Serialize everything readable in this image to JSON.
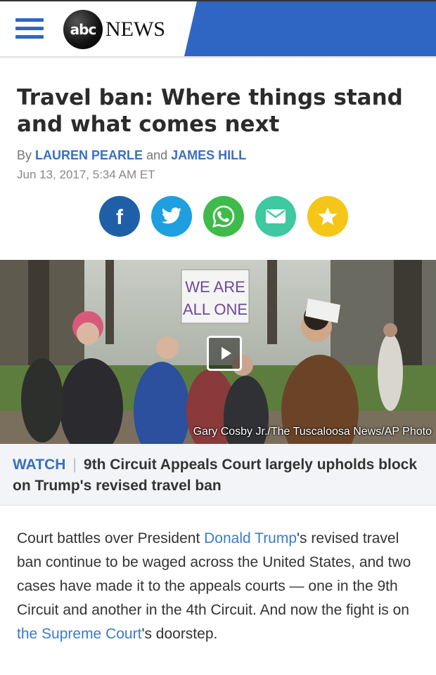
{
  "header": {
    "logo_mark": "abc",
    "logo_text": "NEWS",
    "accent_color": "#2f66c4"
  },
  "article": {
    "headline": "Travel ban: Where things stand and what comes next",
    "byline_prefix": "By",
    "author_1": "LAUREN PEARLE",
    "byline_and": "and",
    "author_2": "JAMES HILL",
    "date": "Jun 13, 2017, 5:34 AM ET"
  },
  "share": [
    {
      "name": "facebook-icon",
      "color": "#1f5fa8"
    },
    {
      "name": "twitter-icon",
      "color": "#1d9fe0"
    },
    {
      "name": "whatsapp-icon",
      "color": "#3ebb4a"
    },
    {
      "name": "email-icon",
      "color": "#3ec9a0"
    },
    {
      "name": "star-icon",
      "color": "#f5c518"
    }
  ],
  "photo": {
    "sign_text_1": "WE ARE",
    "sign_text_2": "ALL ONE",
    "credit": "Gary Cosby Jr./The Tuscaloosa News/AP Photo"
  },
  "video": {
    "watch_label": "WATCH",
    "separator": "|",
    "title": "9th Circuit Appeals Court largely upholds block on Trump's revised travel ban"
  },
  "body": {
    "p1_a": "Court battles over President ",
    "link_1": "Donald Trump",
    "p1_b": "'s revised travel ban continue to be waged across the United States, and two cases have made it to the appeals courts — one in the 9th Circuit and another in the 4th Circuit. And now the fight is on ",
    "link_2": "the Supreme Court",
    "p1_c": "'s doorstep."
  }
}
